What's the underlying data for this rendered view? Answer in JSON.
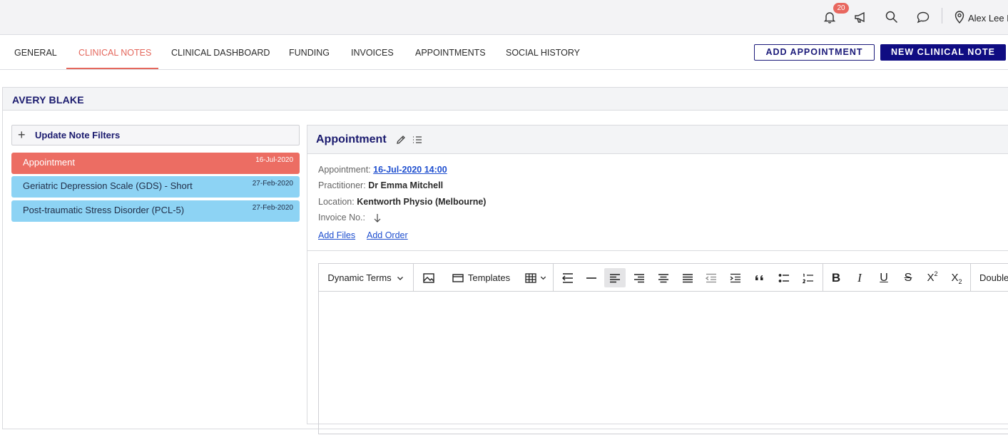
{
  "topbar": {
    "notification_count": "20",
    "user_name": "Alex Lee H",
    "icons": [
      "bell-icon",
      "megaphone-icon",
      "search-icon",
      "chat-icon",
      "location-pin-icon"
    ]
  },
  "tabs": [
    {
      "label": "GENERAL"
    },
    {
      "label": "CLINICAL NOTES",
      "active": true
    },
    {
      "label": "CLINICAL DASHBOARD"
    },
    {
      "label": "FUNDING"
    },
    {
      "label": "INVOICES"
    },
    {
      "label": "APPOINTMENTS"
    },
    {
      "label": "SOCIAL HISTORY"
    }
  ],
  "actions": {
    "add_appointment": "ADD APPOINTMENT",
    "new_clinical_note": "NEW CLINICAL NOTE"
  },
  "patient": {
    "name": "AVERY BLAKE"
  },
  "filters": {
    "label": "Update Note Filters"
  },
  "notes": [
    {
      "title": "Appointment",
      "date": "16-Jul-2020",
      "color": "#ec6d63"
    },
    {
      "title": "Geriatric Depression Scale (GDS) - Short",
      "date": "27-Feb-2020",
      "color": "#8dd3f4"
    },
    {
      "title": "Post-traumatic Stress Disorder (PCL-5)",
      "date": "27-Feb-2020",
      "color": "#8dd3f4"
    }
  ],
  "detail": {
    "title": "Appointment",
    "appointment_label": "Appointment:",
    "appointment_value": "16-Jul-2020 14:00",
    "practitioner_label": "Practitioner:",
    "practitioner_value": "Dr Emma Mitchell",
    "location_label": "Location:",
    "location_value": "Kentworth Physio (Melbourne)",
    "invoice_label": "Invoice No.:",
    "add_files": "Add Files",
    "add_order": "Add Order"
  },
  "editor": {
    "dynamic_terms": "Dynamic Terms",
    "templates": "Templates",
    "line_spacing": "Double"
  }
}
